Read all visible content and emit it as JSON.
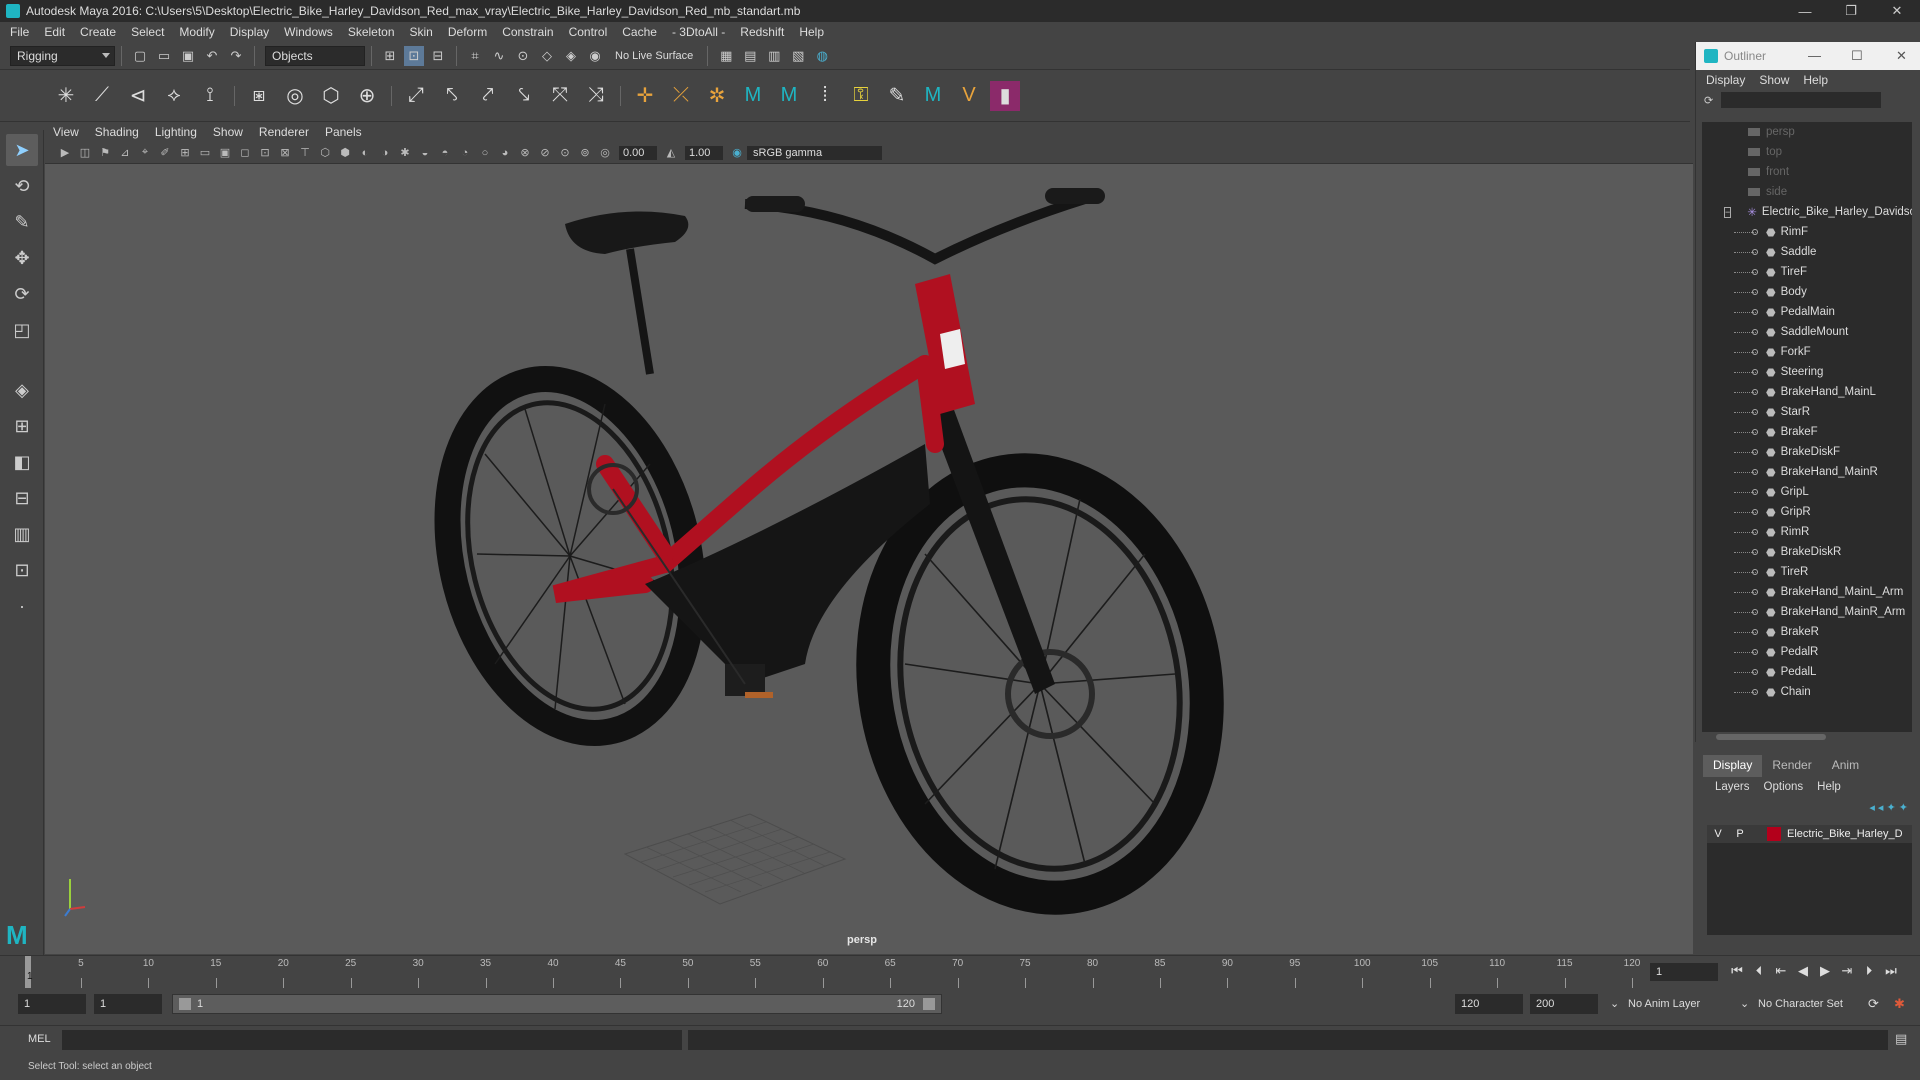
{
  "window": {
    "title": "Autodesk Maya 2016: C:\\Users\\5\\Desktop\\Electric_Bike_Harley_Davidson_Red_max_vray\\Electric_Bike_Harley_Davidson_Red_mb_standart.mb",
    "controls": [
      "—",
      "❐",
      "✕"
    ]
  },
  "menu": [
    "File",
    "Edit",
    "Create",
    "Select",
    "Modify",
    "Display",
    "Windows",
    "Skeleton",
    "Skin",
    "Deform",
    "Constrain",
    "Control",
    "Cache",
    "- 3DtoAll -",
    "Redshift",
    "Help"
  ],
  "status_line": {
    "mode": "Rigging",
    "selection_mode": "Objects",
    "live_surface": "No Live Surface"
  },
  "viewport": {
    "menu": [
      "View",
      "Shading",
      "Lighting",
      "Show",
      "Renderer",
      "Panels"
    ],
    "exposure": "0.00",
    "gamma": "1.00",
    "color_space": "sRGB gamma",
    "camera_label": "persp"
  },
  "outliner": {
    "title": "Outliner",
    "menu": [
      "Display",
      "Show",
      "Help"
    ],
    "cameras": [
      "persp",
      "top",
      "front",
      "side"
    ],
    "group": "Electric_Bike_Harley_Davidso",
    "children": [
      "RimF",
      "Saddle",
      "TireF",
      "Body",
      "PedalMain",
      "SaddleMount",
      "ForkF",
      "Steering",
      "BrakeHand_MainL",
      "StarR",
      "BrakeF",
      "BrakeDiskF",
      "BrakeHand_MainR",
      "GripL",
      "GripR",
      "RimR",
      "BrakeDiskR",
      "TireR",
      "BrakeHand_MainL_Arm",
      "BrakeHand_MainR_Arm",
      "BrakeR",
      "PedalR",
      "PedalL",
      "Chain"
    ]
  },
  "layers": {
    "tabs": [
      "Display",
      "Render",
      "Anim"
    ],
    "menu": [
      "Layers",
      "Options",
      "Help"
    ],
    "row": {
      "v": "V",
      "p": "P",
      "name": "Electric_Bike_Harley_D",
      "color": "#b3001b"
    }
  },
  "timeline": {
    "ticks": [
      1,
      5,
      10,
      15,
      20,
      25,
      30,
      35,
      40,
      45,
      50,
      55,
      60,
      65,
      70,
      75,
      80,
      85,
      90,
      95,
      100,
      105,
      110,
      115,
      120
    ],
    "current_frame": "1",
    "start": "1",
    "playback_start": "1",
    "range_start": "1",
    "range_end": "120",
    "playback_end": "120",
    "anim_end": "200",
    "anim_layer": "No Anim Layer",
    "character_set": "No Character Set"
  },
  "command_line": {
    "label": "MEL",
    "help": "Select Tool: select an object"
  }
}
